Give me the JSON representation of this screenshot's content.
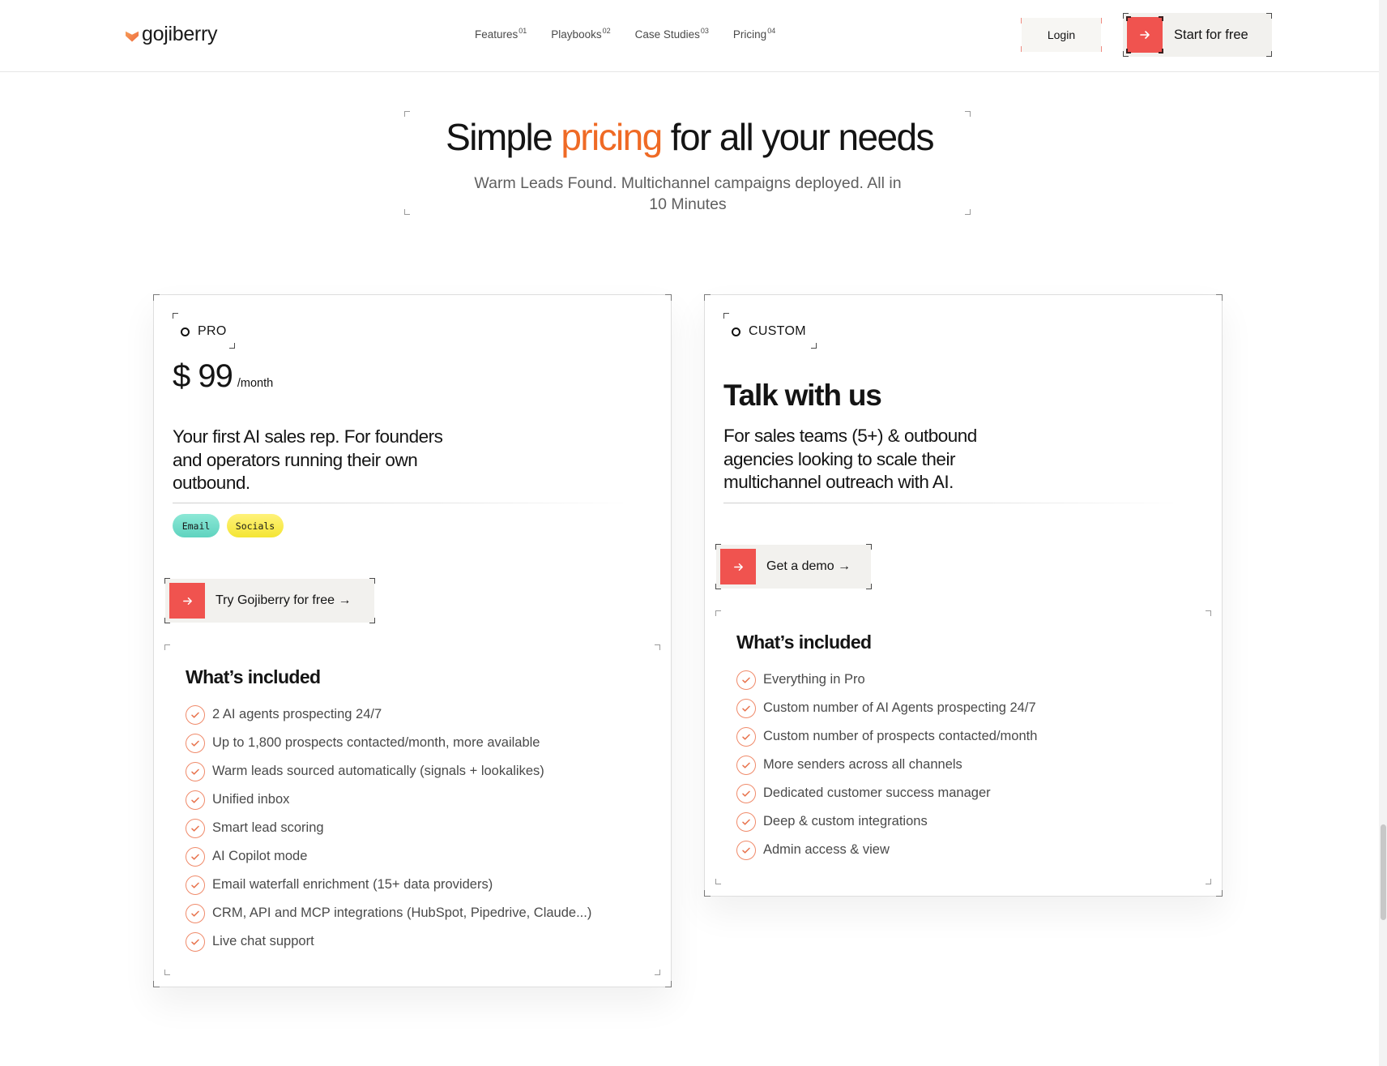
{
  "header": {
    "logo_text": "gojiberry",
    "nav": [
      {
        "label": "Features",
        "num": "01"
      },
      {
        "label": "Playbooks",
        "num": "02"
      },
      {
        "label": "Case Studies",
        "num": "03"
      },
      {
        "label": "Pricing",
        "num": "04"
      }
    ],
    "login_label": "Login",
    "cta_label": "Start for free"
  },
  "hero": {
    "title_pre": "Simple ",
    "title_accent": "pricing",
    "title_post": " for all your needs",
    "accent_color": "#ef6a25",
    "subtitle": "Warm Leads Found. Multichannel campaigns deployed. All in 10 Minutes"
  },
  "pro": {
    "tag": "PRO",
    "price": "$ 99",
    "period": "/month",
    "description": "Your first AI sales rep. For founders and operators running their own outbound.",
    "pills": [
      "Email",
      "Socials"
    ],
    "cta_label": "Try Gojiberry for free →",
    "included_title": "What’s included",
    "features": [
      "2 AI agents prospecting 24/7",
      "Up to 1,800 prospects contacted/month, more available",
      "Warm leads sourced automatically (signals + lookalikes)",
      "Unified inbox",
      "Smart lead scoring",
      "AI Copilot mode",
      "Email waterfall enrichment (15+ data providers)",
      "CRM, API and MCP integrations (HubSpot, Pipedrive, Claude...)",
      "Live chat support"
    ]
  },
  "custom": {
    "tag": "CUSTOM",
    "title": "Talk with us",
    "description": "For sales teams (5+) & outbound agencies looking to scale their multichannel outreach with AI.",
    "cta_label": "Get a demo →",
    "included_title": "What’s included",
    "features": [
      "Everything in Pro",
      "Custom number of AI Agents prospecting 24/7",
      "Custom number of prospects contacted/month",
      "More senders across all channels",
      "Dedicated customer success manager",
      "Deep & custom integrations",
      "Admin access & view"
    ]
  },
  "colors": {
    "brand_red": "#f0534f",
    "check_orange": "#f08a6a"
  }
}
